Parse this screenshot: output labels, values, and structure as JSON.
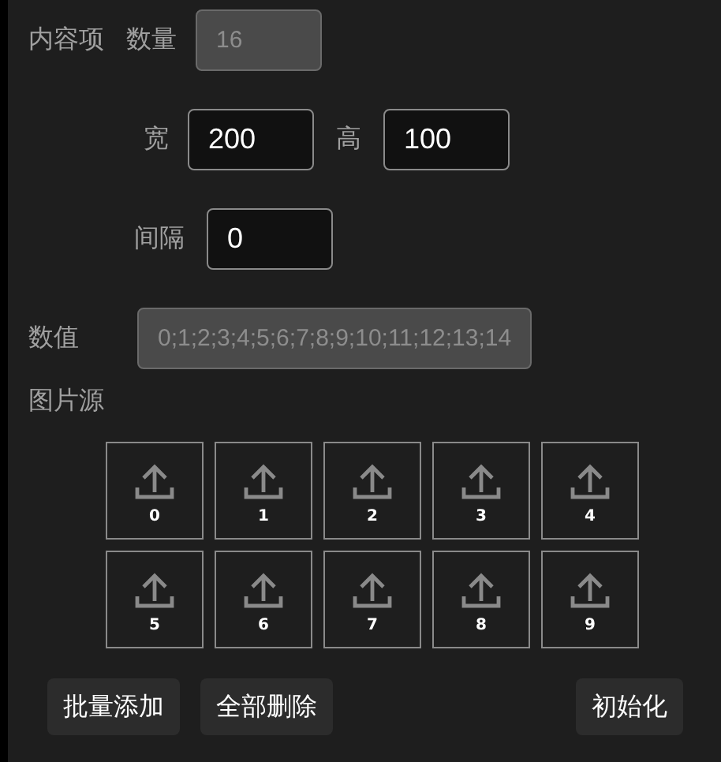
{
  "content_item": {
    "label": "内容项",
    "count": {
      "label": "数量",
      "value": "16",
      "disabled": true
    }
  },
  "size": {
    "width": {
      "label": "宽",
      "value": "200",
      "disabled": false
    },
    "height": {
      "label": "高",
      "value": "100",
      "disabled": false
    }
  },
  "spacing": {
    "label": "间隔",
    "value": "0",
    "disabled": false
  },
  "values": {
    "label": "数值",
    "value": "0;1;2;3;4;5;6;7;8;9;10;11;12;13;14",
    "disabled": true
  },
  "image_source": {
    "label": "图片源",
    "tiles": [
      {
        "label": "0"
      },
      {
        "label": "1"
      },
      {
        "label": "2"
      },
      {
        "label": "3"
      },
      {
        "label": "4"
      },
      {
        "label": "5"
      },
      {
        "label": "6"
      },
      {
        "label": "7"
      },
      {
        "label": "8"
      },
      {
        "label": "9"
      }
    ]
  },
  "buttons": [
    {
      "label": "批量添加"
    },
    {
      "label": "全部删除"
    },
    {
      "label": "初始化"
    }
  ]
}
